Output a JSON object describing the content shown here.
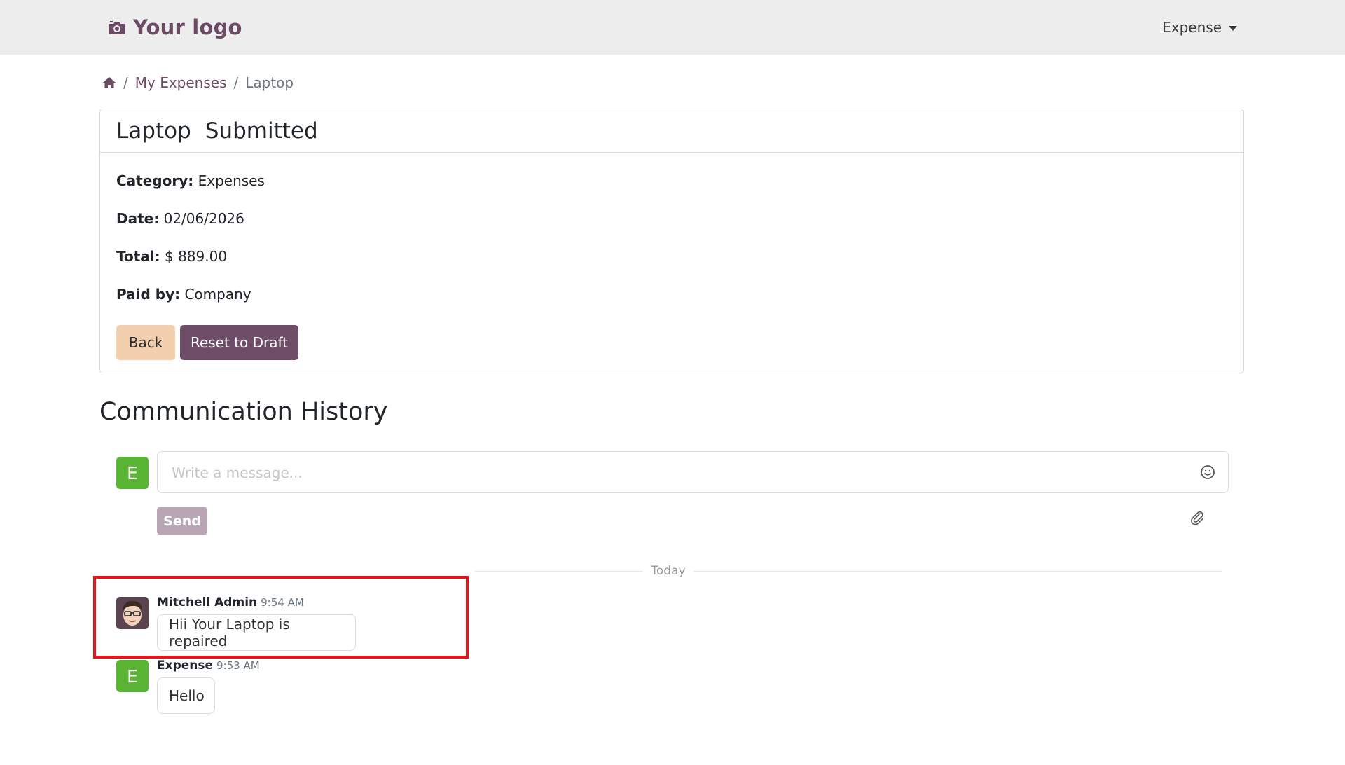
{
  "navbar": {
    "logo_text": "Your logo",
    "menu_label": "Expense"
  },
  "breadcrumb": {
    "items": [
      "My Expenses",
      "Laptop"
    ]
  },
  "expense": {
    "name": "Laptop",
    "status": "Submitted",
    "fields": [
      {
        "label": "Category:",
        "value": "Expenses"
      },
      {
        "label": "Date:",
        "value": "02/06/2026"
      },
      {
        "label": "Total:",
        "value": "$ 889.00"
      },
      {
        "label": "Paid by:",
        "value": "Company"
      }
    ],
    "back_label": "Back",
    "reset_label": "Reset to Draft"
  },
  "communication": {
    "title": "Communication History",
    "composer_avatar": "E",
    "placeholder": "Write a message...",
    "send_label": "Send",
    "divider_label": "Today",
    "messages": [
      {
        "author": "Mitchell Admin",
        "time": "9:54 AM",
        "text": "Hii Your Laptop is repaired"
      },
      {
        "author": "Expense",
        "avatar": "E",
        "time": "9:53 AM",
        "text": "Hello"
      }
    ]
  },
  "colors": {
    "brand": "#6b4a64",
    "navbar_bg": "#ededed",
    "back_button": "#f3cfae",
    "reset_button": "#6f4d69",
    "send_button": "#b8a6b5",
    "avatar_green": "#5ab534",
    "highlight": "#e4161b"
  },
  "icons": {
    "logo": "camera-icon",
    "home": "home-icon",
    "emoji": "smiley-icon",
    "attach": "paperclip-icon"
  }
}
